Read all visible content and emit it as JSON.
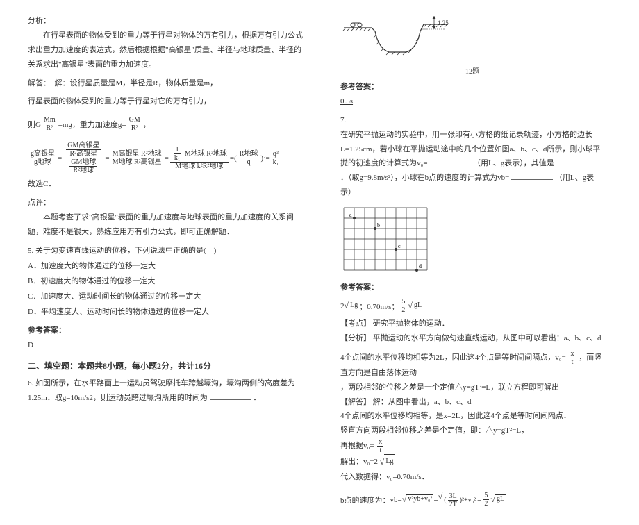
{
  "left": {
    "analysis_label": "分析：",
    "analysis_p1": "　　在行星表面的物体受到的重力等于行星对物体的万有引力，根据万有引力公式求出重力加速度的表达式，然后根据根据\"高银星\"质量、半径与地球质量、半径的关系求出\"高银星\"表面的重力加速度。",
    "solve_label": "解答：　解：设行星质量是M，半径是R，物体质量是m，",
    "solve_p1": "行星表面的物体受到的重力等于行星对它的万有引力，",
    "eq1_prefix": "则G",
    "eq1_mid": "=mg，重力加速度g=",
    "eq1_suffix": "，",
    "eq2_prefix": "",
    "eq2_frac_top_1": "GM高银星",
    "eq2_den_1": "R²高银星",
    "eq2_over": "g高银星",
    "eq2_g_earth": "g地球",
    "eq2_mid1": "=",
    "eq2_mid2": "=",
    "eq2_mid3": "=",
    "eq2_mid4": "=",
    "eq2_mid5": "=",
    "eq2_frac_top_2": "GM地球",
    "eq2_den_2": "R²地球",
    "eq2_frac_top_3": "M高银星 R²地球",
    "eq2_den_3": "M地球 R²高银星",
    "eq2_frac_top_4": "k M地球 R²地球",
    "eq2_den_4": "M地球 k²R²地球",
    "eq2_frac_top_5": "1",
    "eq2_den_5": "k₁",
    "eq2_frac_rearth_num": "R地球",
    "eq2_frac_rearth_den": "q",
    "eq2_sq": "²",
    "eq2_final_num": "q²",
    "eq2_final_den": "k₁",
    "eq2_suffix": "",
    "conclude": "故选C．",
    "review_label": "点评：",
    "review_p1": "　　本题考查了求\"高银星\"表面的重力加速度与地球表面的重力加速度的关系问题，难度不是很大，熟练应用万有引力公式，即可正确解题．",
    "q5_stem": "5. 关于匀变速直线运动的位移，下列说法中正确的是(　)",
    "q5_a": "A．加速度大的物体通过的位移一定大",
    "q5_b": "B．初速度大的物体通过的位移一定大",
    "q5_c": "C．加速度大、运动时间长的物体通过的位移一定大",
    "q5_d": "D．平均速度大、运动时间长的物体通过的位移一定大",
    "ref_ans_label": "参考答案：",
    "q5_ans": "D",
    "section2": "二、填空题：本题共8小题，每小题2分，共计16分",
    "q6_stem_a": "6. 如图所示，在水平路面上一运动员驾驶摩托车跨越壕沟，壕沟两侧的高度差为1.25m．取g=10m/s2，则运动员跨过壕沟所用的时间为",
    "q6_stem_b": "．"
  },
  "right": {
    "fig12_label": "12题",
    "fig12_height": "1.25",
    "ref_ans_label": "参考答案：",
    "q6_ans": "0.5s",
    "q7_num": "7.",
    "q7_stem_a": "在研究平抛运动的实验中，用一张印有小方格的纸记录轨迹，小方格的边长L=1.25cm，若小球在平抛运动途中的几个位置如图a、b、c、d所示，则小球平抛的初速度的计算式为v₀=",
    "q7_stem_b": "（用L、g表示），其值是",
    "q7_stem_c": "．（取g=9.8m/s²），小球在b点的速度的计算式为vb=",
    "q7_stem_d": "（用L、g表示）",
    "ref_ans_label2": "参考答案：",
    "q7_ans_prefix": "2",
    "q7_ans_sqrt": "Lg",
    "q7_ans_mid": "；0.70m/s；",
    "q7_ans_frac_num": "5",
    "q7_ans_frac_den": "2",
    "q7_ans_sqrt2": "gL",
    "q7_kp_label": "【考点】",
    "q7_kp": "研究平抛物体的运动．",
    "q7_an_label": "【分析】",
    "q7_an": "平抛运动的水平方向做匀速直线运动，从图中可以看出：a、b、c、d",
    "q7_p1_a": "4个点间的水平位移均相等为2L，因此这4个点是等时间间隔点，v₀=",
    "q7_p1_frac_num": "x",
    "q7_p1_frac_den": "t",
    "q7_p1_b": "，而竖直方向是自由落体运动",
    "q7_p2": "，两段相邻的位移之差是一个定值△y=gT²=L，联立方程即可解出",
    "q7_sol_label": "【解答】",
    "q7_sol": "解：从图中看出，a、b、c、d",
    "q7_p3": "4个点间的水平位移均相等，是x=2L，因此这4个点是等时间间隔点．",
    "q7_p4": "竖直方向两段相邻位移之差是个定值，即：△y=gT²=L，",
    "q7_p5_a": "再根据v₀=",
    "q7_p5_frac_num": "x",
    "q7_p5_frac_den": "t",
    "q7_p6": "解出：v₀=2",
    "q7_p6_sqrt": "Lg",
    "q7_p7": "代入数据得：v₀=0.70m/s．",
    "q7_p8_a": "b点的速度为：",
    "q7_p8_vb": "vb",
    "q7_p8_eq": "=",
    "q7_p8_sqrt1_a": "v²yb",
    "q7_p8_plus": "+v₀²",
    "q7_p8_eq2": "=",
    "q7_p8_frac1_num": "3L",
    "q7_p8_frac1_den": "2T",
    "q7_p8_sq": "²",
    "q7_p8_plus2": "+v₀²",
    "q7_p8_eq3": "=",
    "q7_p8_frac2_num": "5",
    "q7_p8_frac2_den": "2",
    "q7_p8_sqrt3": "gL"
  }
}
